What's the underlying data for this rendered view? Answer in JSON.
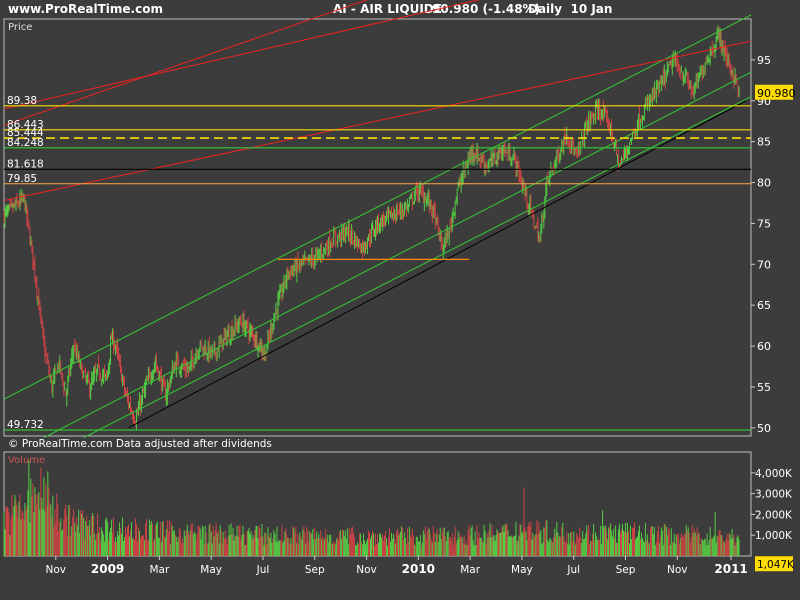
{
  "header": {
    "site": "www.ProRealTime.com",
    "instrument": "AI - AIR LIQUIDE",
    "quote": "90.980 (-1.48%)",
    "period": "Daily  10 Jan"
  },
  "colors": {
    "background": "#3c3c3c",
    "bull": "#55cc44",
    "bear": "#cc4444",
    "channel_green": "#33cc33",
    "trend_red": "#ee2222",
    "level_yellow": "#ffdd00",
    "level_orange": "#ff8800",
    "axis_text": "#ffffff"
  },
  "chart_data": [
    {
      "type": "candlestick",
      "panel_title": "Price",
      "credit": "© ProRealTime.com  Data adjusted after dividends",
      "ylim": [
        49,
        100
      ],
      "y_ticks": [
        50,
        55,
        60,
        65,
        70,
        75,
        80,
        85,
        90,
        95
      ],
      "y_tick_labels": [
        "50",
        "55",
        "60",
        "65",
        "70",
        "75",
        "80",
        "85",
        "90",
        "95"
      ],
      "x_ticks": [
        {
          "t": 52,
          "label": "Nov"
        },
        {
          "t": 104,
          "label": "2009"
        },
        {
          "t": 156,
          "label": "Mar"
        },
        {
          "t": 208,
          "label": "May"
        },
        {
          "t": 260,
          "label": "Jul"
        },
        {
          "t": 312,
          "label": "Sep"
        },
        {
          "t": 364,
          "label": "Nov"
        },
        {
          "t": 416,
          "label": "2010"
        },
        {
          "t": 468,
          "label": "Mar"
        },
        {
          "t": 520,
          "label": "May"
        },
        {
          "t": 572,
          "label": "Jul"
        },
        {
          "t": 624,
          "label": "Sep"
        },
        {
          "t": 676,
          "label": "Nov"
        },
        {
          "t": 730,
          "label": "2011"
        }
      ],
      "x_range": [
        0,
        750
      ],
      "last_price": "90.980",
      "close_path": [
        [
          0,
          76
        ],
        [
          10,
          77
        ],
        [
          20,
          78
        ],
        [
          30,
          70
        ],
        [
          40,
          60
        ],
        [
          48,
          55
        ],
        [
          55,
          58
        ],
        [
          62,
          54
        ],
        [
          70,
          60
        ],
        [
          78,
          57
        ],
        [
          86,
          55
        ],
        [
          94,
          57
        ],
        [
          103,
          56
        ],
        [
          108,
          61
        ],
        [
          112,
          60
        ],
        [
          122,
          54
        ],
        [
          132,
          51
        ],
        [
          142,
          55
        ],
        [
          152,
          58
        ],
        [
          162,
          54
        ],
        [
          172,
          58
        ],
        [
          185,
          57
        ],
        [
          196,
          60
        ],
        [
          210,
          59
        ],
        [
          222,
          61
        ],
        [
          238,
          63
        ],
        [
          252,
          61
        ],
        [
          262,
          59
        ],
        [
          272,
          64
        ],
        [
          285,
          69
        ],
        [
          300,
          70
        ],
        [
          315,
          71
        ],
        [
          330,
          73
        ],
        [
          345,
          74
        ],
        [
          360,
          72
        ],
        [
          375,
          75
        ],
        [
          390,
          76
        ],
        [
          405,
          77
        ],
        [
          415,
          79
        ],
        [
          425,
          78
        ],
        [
          432,
          76
        ],
        [
          440,
          72
        ],
        [
          447,
          74
        ],
        [
          455,
          79
        ],
        [
          470,
          84
        ],
        [
          485,
          82
        ],
        [
          500,
          84
        ],
        [
          512,
          83
        ],
        [
          520,
          80
        ],
        [
          530,
          76
        ],
        [
          538,
          73
        ],
        [
          545,
          80
        ],
        [
          555,
          83
        ],
        [
          565,
          86
        ],
        [
          575,
          83
        ],
        [
          585,
          87
        ],
        [
          597,
          89
        ],
        [
          608,
          87
        ],
        [
          618,
          82
        ],
        [
          625,
          84
        ],
        [
          635,
          87
        ],
        [
          648,
          90
        ],
        [
          660,
          92
        ],
        [
          672,
          95
        ],
        [
          683,
          93
        ],
        [
          692,
          91
        ],
        [
          705,
          95
        ],
        [
          718,
          98
        ],
        [
          726,
          95
        ],
        [
          733,
          93
        ],
        [
          738,
          91
        ]
      ],
      "horizontal_levels": [
        {
          "label": "89.38",
          "value": 89.38,
          "color": "#ffdd00",
          "style": "solid"
        },
        {
          "label": "86.443",
          "value": 86.443,
          "color": "#ffdd00",
          "style": "solid"
        },
        {
          "label": "85.444",
          "value": 85.444,
          "color": "#ffdd00",
          "style": "dashed"
        },
        {
          "label": "84.248",
          "value": 84.248,
          "color": "#33cc33",
          "style": "solid"
        },
        {
          "label": "81.618",
          "value": 81.618,
          "color": "#000000",
          "style": "solid"
        },
        {
          "label": "79.85",
          "value": 79.85,
          "color": "#ffaa44",
          "style": "solid"
        },
        {
          "label": "49.732",
          "value": 49.732,
          "color": "#33cc33",
          "style": "solid"
        }
      ],
      "support_segment": {
        "t1": 275,
        "t2": 467,
        "value": 70.6
      },
      "trendlines": [
        {
          "color": "#33cc33",
          "from": [
            0,
            53.5
          ],
          "to": [
            750,
            100.5
          ]
        },
        {
          "color": "#33cc33",
          "from": [
            40,
            48.8
          ],
          "to": [
            750,
            93.5
          ]
        },
        {
          "color": "#33cc33",
          "from": [
            80,
            48.8
          ],
          "to": [
            750,
            90.5
          ]
        },
        {
          "color": "#000000",
          "from": [
            125,
            50.0
          ],
          "to": [
            745,
            90.0
          ]
        },
        {
          "color": "#ee2222",
          "from": [
            0,
            77.8
          ],
          "to": [
            750,
            97.3
          ]
        },
        {
          "color": "#ee2222",
          "from": [
            0,
            87.0
          ],
          "to": [
            380,
            103.0
          ]
        },
        {
          "color": "#ee2222",
          "from": [
            0,
            89.0
          ],
          "to": [
            500,
            103.0
          ]
        }
      ]
    },
    {
      "type": "bar",
      "panel_title": "Volume",
      "ylim": [
        0,
        5000
      ],
      "y_ticks": [
        1000,
        2000,
        3000,
        4000
      ],
      "y_tick_labels": [
        "1,000K",
        "2,000K",
        "3,000K",
        "4,000K"
      ],
      "last_value": "1,047K",
      "volume_path": [
        [
          0,
          2100
        ],
        [
          15,
          2400
        ],
        [
          30,
          3000
        ],
        [
          40,
          3300
        ],
        [
          50,
          2600
        ],
        [
          60,
          2000
        ],
        [
          80,
          1700
        ],
        [
          100,
          1500
        ],
        [
          130,
          1400
        ],
        [
          160,
          1300
        ],
        [
          200,
          1200
        ],
        [
          250,
          1150
        ],
        [
          300,
          1100
        ],
        [
          350,
          1050
        ],
        [
          400,
          1050
        ],
        [
          450,
          1100
        ],
        [
          500,
          1200
        ],
        [
          520,
          1500
        ],
        [
          540,
          1300
        ],
        [
          580,
          1200
        ],
        [
          620,
          1250
        ],
        [
          660,
          1150
        ],
        [
          700,
          1100
        ],
        [
          740,
          1000
        ]
      ],
      "volume_spikes": [
        {
          "t": 25,
          "value": 4600
        },
        {
          "t": 37,
          "value": 4250
        },
        {
          "t": 42,
          "value": 3500
        },
        {
          "t": 522,
          "value": 3300
        },
        {
          "t": 601,
          "value": 2200
        },
        {
          "t": 714,
          "value": 2100
        }
      ]
    }
  ]
}
